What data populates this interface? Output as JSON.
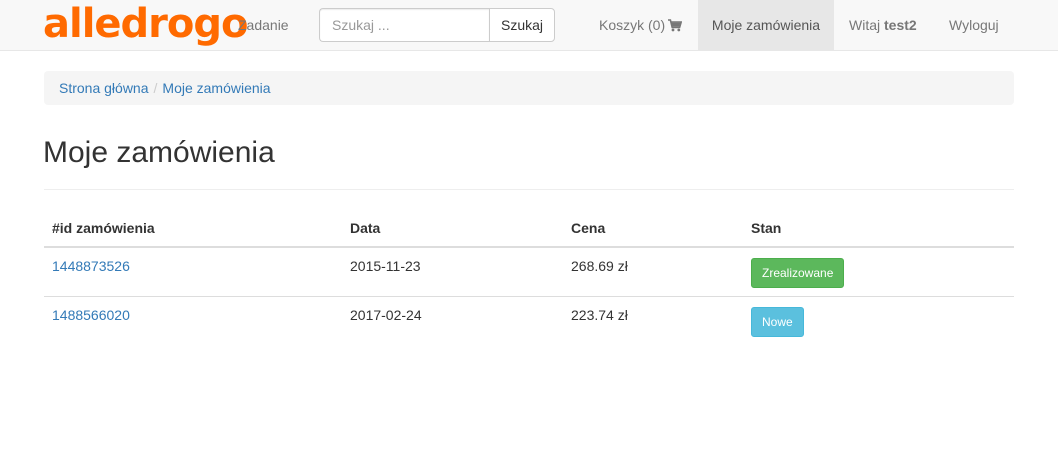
{
  "brand": {
    "logo_text": "alledrogo",
    "color": "#ff6a00"
  },
  "navbar": {
    "task_label": "Zadanie",
    "search": {
      "placeholder": "Szukaj ...",
      "value": "",
      "button_label": "Szukaj"
    },
    "cart_label": "Koszyk (0)",
    "cart_icon": "shopping-cart-icon",
    "orders_label": "Moje zamówienia",
    "greeting": "Witaj",
    "username": "test2",
    "logout_label": "Wyloguj"
  },
  "breadcrumb": [
    {
      "label": "Strona główna"
    },
    {
      "label": "Moje zamówienia"
    }
  ],
  "page": {
    "title": "Moje zamówienia"
  },
  "orders_table": {
    "headers": [
      "#id zamówienia",
      "Data",
      "Cena",
      "Stan"
    ],
    "rows": [
      {
        "id": "1448873526",
        "date": "2015-11-23",
        "price": "268.69 zł",
        "status": "Zrealizowane",
        "status_color": "#5cb85c"
      },
      {
        "id": "1488566020",
        "date": "2017-02-24",
        "price": "223.74 zł",
        "status": "Nowe",
        "status_color": "#5bc0de"
      }
    ]
  }
}
